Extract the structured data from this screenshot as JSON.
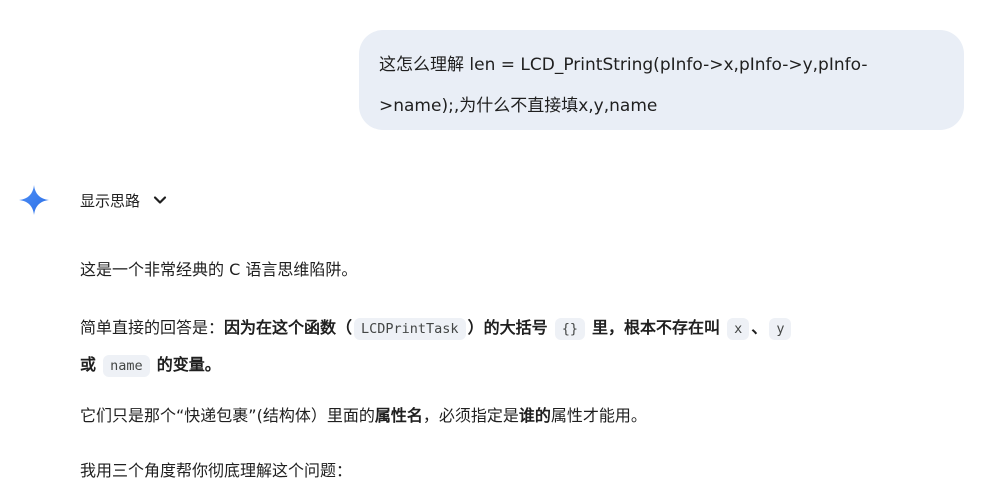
{
  "user_message": {
    "line1": "这怎么理解 len = LCD_PrintString(pInfo->x,pInfo->y,pInfo-",
    "line2": ">name);,为什么不直接填x,y,name"
  },
  "thoughts_toggle": {
    "label": "显示思路",
    "icon": "chevron-down-icon"
  },
  "assistant_icon": "gemini-sparkle-icon",
  "colors": {
    "bubble_bg": "#e9eef6",
    "code_bg": "#eef1f6",
    "gem_blue": "#3c7bf0"
  },
  "response": {
    "p1": "这是一个非常经典的 C 语言思维陷阱。",
    "p2": {
      "lead": "简单直接的回答是：",
      "bold1": "因为在这个函数（",
      "code1": "LCDPrintTask",
      "bold2": "）的大括号",
      "code2": "{}",
      "bold3": "里，根本不存在叫",
      "code3": "x",
      "sep1": "、",
      "code4": "y",
      "bold4": "或",
      "code5": "name",
      "bold5": "的变量。"
    },
    "p3": {
      "text1": "它们只是那个“快递包裹”(结构体）里面的",
      "bold1": "属性名",
      "text2": "，必须指定是",
      "bold2": "谁的",
      "text3": "属性才能用。"
    },
    "p4": "我用三个角度帮你彻底理解这个问题："
  }
}
